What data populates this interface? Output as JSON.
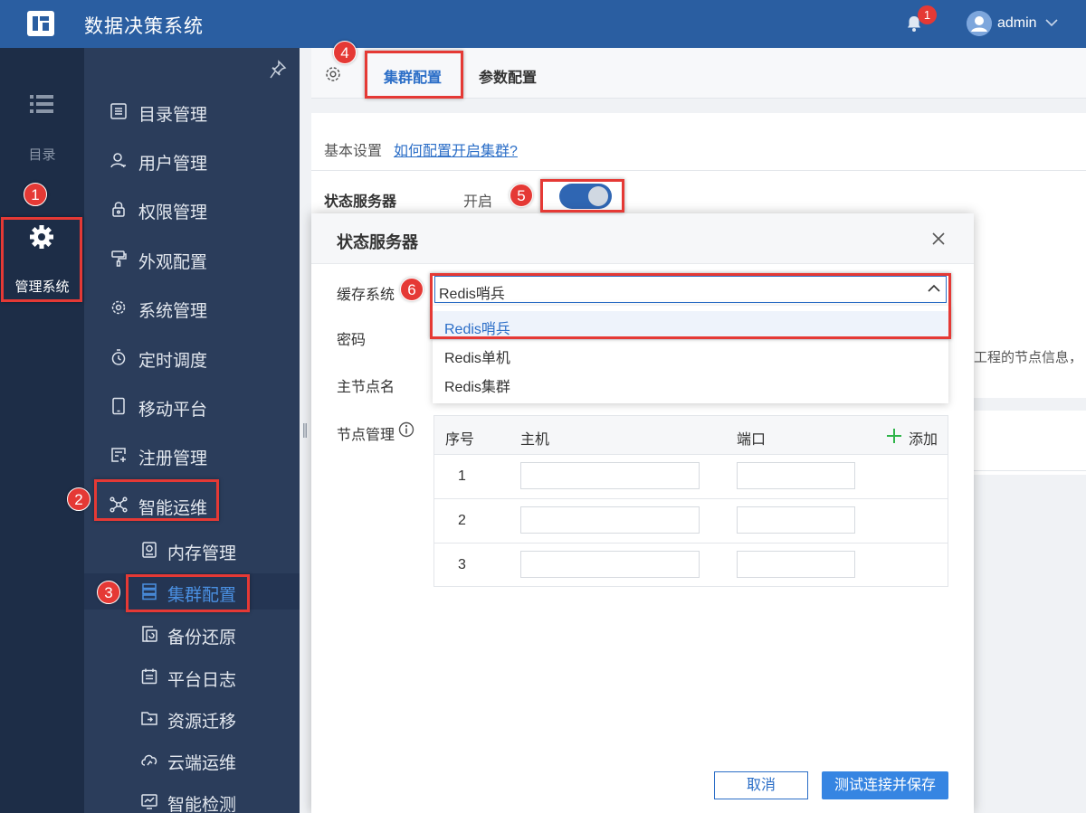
{
  "app": {
    "title": "数据决策系统",
    "notification_count": "1",
    "username": "admin"
  },
  "iconbar": {
    "directory_label": "目录",
    "manage_label": "管理系统"
  },
  "menu": [
    {
      "label": "目录管理",
      "icon": "list-doc-icon"
    },
    {
      "label": "用户管理",
      "icon": "user-icon"
    },
    {
      "label": "权限管理",
      "icon": "lock-icon"
    },
    {
      "label": "外观配置",
      "icon": "brush-icon"
    },
    {
      "label": "系统管理",
      "icon": "gear-icon"
    },
    {
      "label": "定时调度",
      "icon": "timer-icon"
    },
    {
      "label": "移动平台",
      "icon": "tablet-icon"
    },
    {
      "label": "注册管理",
      "icon": "register-icon"
    },
    {
      "label": "智能运维",
      "icon": "network-icon"
    }
  ],
  "submenu": [
    {
      "label": "内存管理",
      "icon": "memory-icon"
    },
    {
      "label": "集群配置",
      "icon": "server-icon",
      "active": true
    },
    {
      "label": "备份还原",
      "icon": "backup-icon"
    },
    {
      "label": "平台日志",
      "icon": "calendar-log-icon"
    },
    {
      "label": "资源迁移",
      "icon": "folder-move-icon"
    },
    {
      "label": "云端运维",
      "icon": "cloud-icon"
    },
    {
      "label": "智能检测",
      "icon": "monitor-icon"
    }
  ],
  "tabs": {
    "cluster": "集群配置",
    "params": "参数配置"
  },
  "page": {
    "basic_settings": "基本设置",
    "help_link": "如何配置开启集群?",
    "state_server": "状态服务器",
    "state_on": "开启",
    "bg_text": "工程的节点信息，"
  },
  "dialog": {
    "title": "状态服务器",
    "cache_label": "缓存系统",
    "cache_value": "Redis哨兵",
    "cache_options": [
      "Redis哨兵",
      "Redis单机",
      "Redis集群"
    ],
    "password_label": "密码",
    "master_label": "主节点名",
    "node_label": "节点管理",
    "table_headers": {
      "no": "序号",
      "host": "主机",
      "port": "端口",
      "add": "添加"
    },
    "rows": [
      "1",
      "2",
      "3"
    ],
    "cancel": "取消",
    "save": "测试连接并保存"
  },
  "annotations": [
    "1",
    "2",
    "3",
    "4",
    "5",
    "6"
  ],
  "colors": {
    "topbar": "#2a5ea1",
    "sidebar": "#2b3d5b",
    "iconbar": "#1d2d47",
    "accent": "#2b6ec7",
    "callout": "#e53935"
  }
}
